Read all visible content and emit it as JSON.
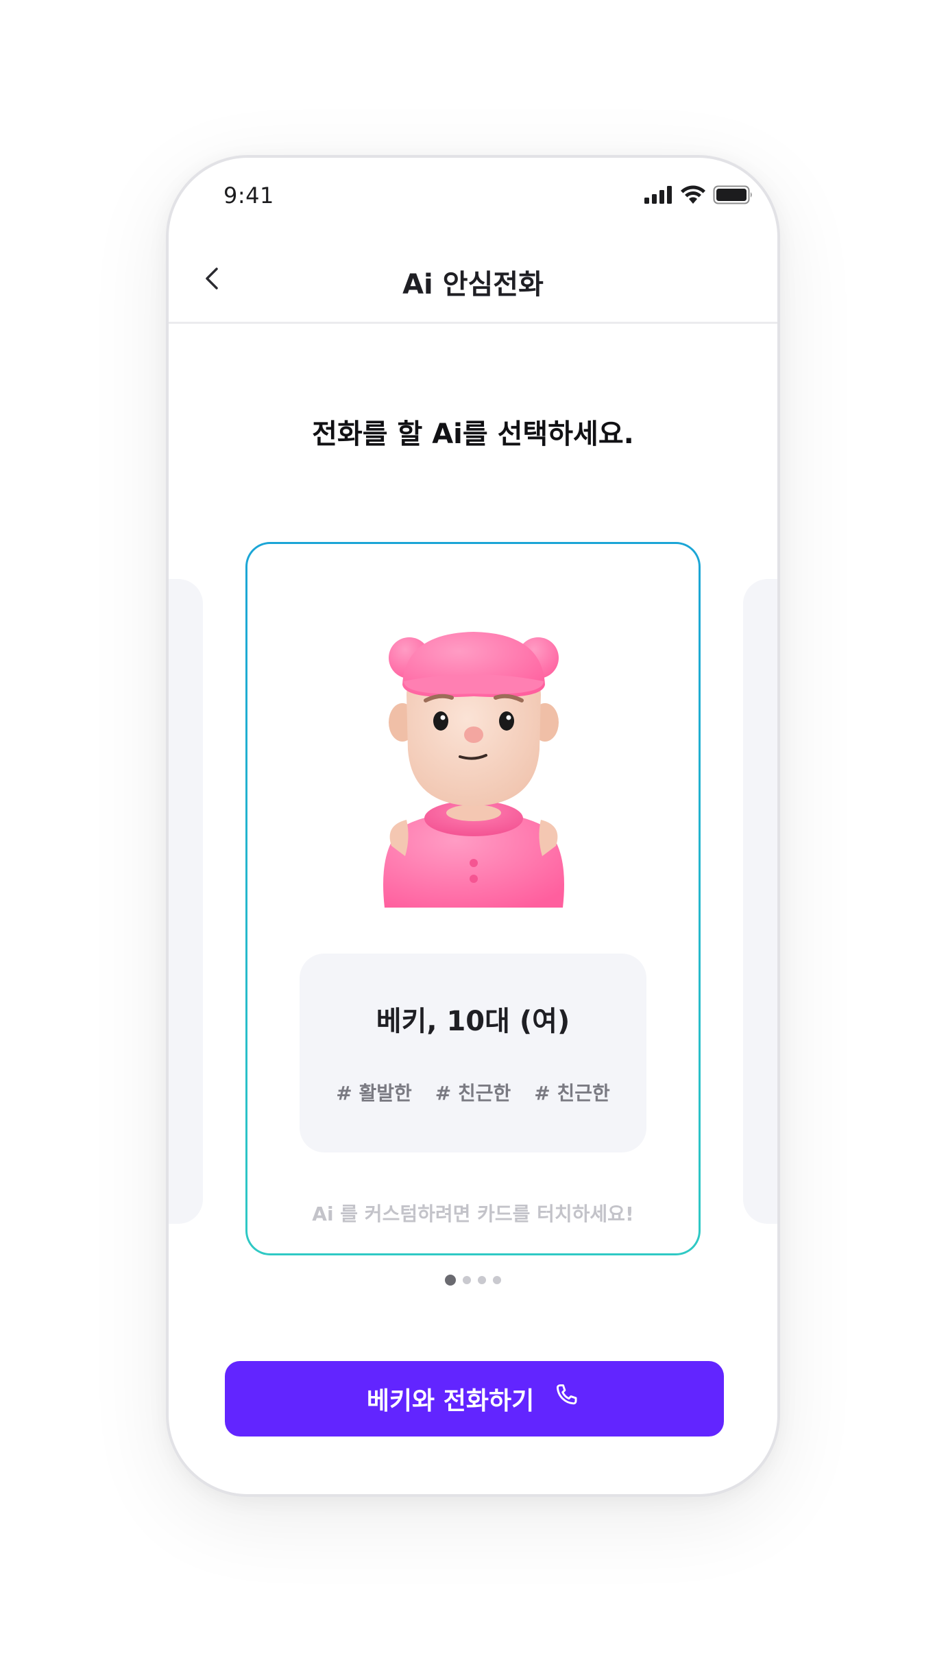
{
  "status_bar": {
    "time": "9:41"
  },
  "nav": {
    "title": "Ai 안심전화"
  },
  "prompt": "전화를 할 Ai를 선택하세요.",
  "card": {
    "name": "베키, 10대 (여)",
    "tags": [
      "# 활발한",
      "# 친근한",
      "# 친근한"
    ],
    "hint": "Ai 를 커스텀하려면 카드를 터치하세요!"
  },
  "pagination": {
    "total": 4,
    "active": 1
  },
  "call_button": {
    "label": "베키와 전화하기"
  },
  "colors": {
    "accent": "#6225ff",
    "card_border_top": "#1ba5d6",
    "card_border_bottom": "#2fc9c4",
    "avatar_pink": "#ff6fa8"
  }
}
